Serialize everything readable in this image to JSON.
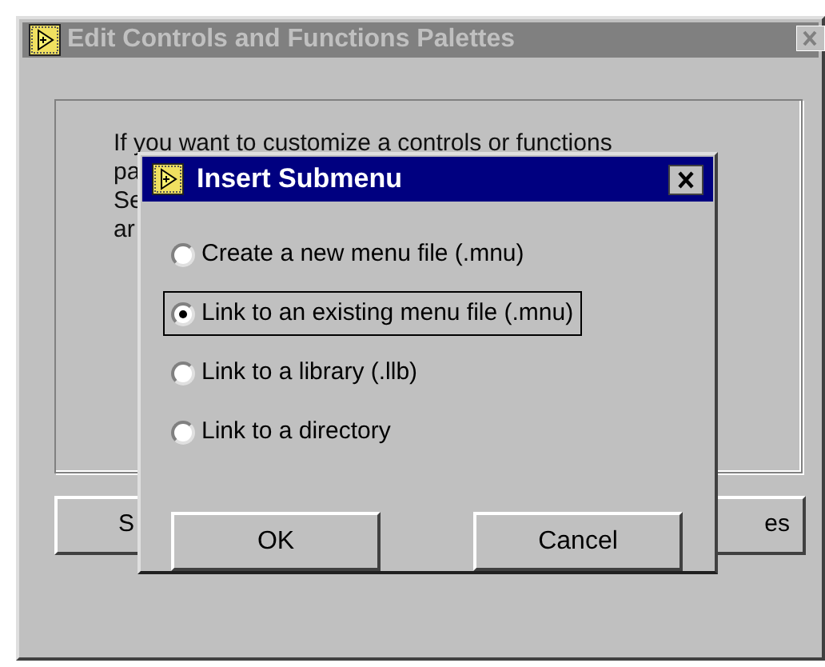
{
  "window": {
    "title": "Edit Controls and Functions Palettes",
    "active": false
  },
  "background_text": [
    "If you want to customize a controls or functions",
    "pa",
    "Se",
    "ar"
  ],
  "background_buttons": [
    "S",
    "es"
  ],
  "dialog": {
    "title": "Insert Submenu",
    "active": true,
    "options": [
      {
        "label": "Create a new menu file (.mnu)",
        "selected": false
      },
      {
        "label": "Link to an existing menu file (.mnu)",
        "selected": true
      },
      {
        "label": "Link to a library (.llb)",
        "selected": false
      },
      {
        "label": "Link to a directory",
        "selected": false
      }
    ],
    "buttons": [
      "OK",
      "Cancel"
    ]
  }
}
